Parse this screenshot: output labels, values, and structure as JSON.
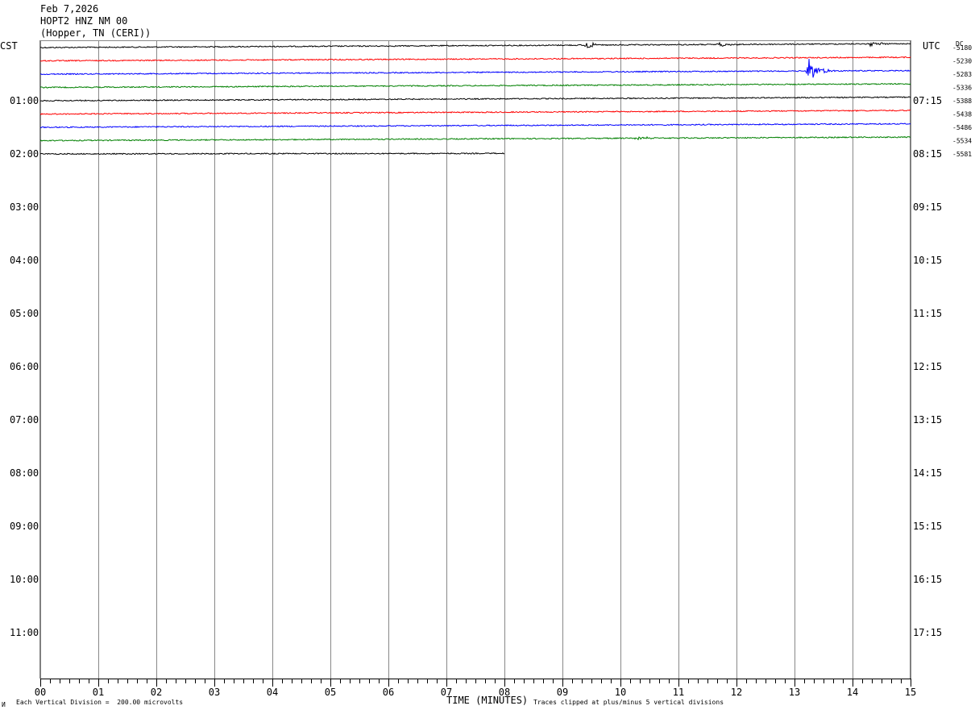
{
  "header": {
    "date": "Feb 7,2026",
    "station": "HOPT2 HNZ NM 00",
    "location": "(Hopper, TN (CERI))"
  },
  "left_timezone": "CST",
  "right_timezone": "UTC",
  "dc_header": "DC",
  "footer": {
    "corner_mark": "И",
    "scale_note": "Each Vertical Division =  200.00 microvolts",
    "axis_title": "TIME (MINUTES)",
    "clip_note": "Traces clipped at plus/minus 5 vertical divisions"
  },
  "colors": {
    "grid": "#888888",
    "traces": [
      "#000000",
      "#ff0000",
      "#0000ff",
      "#008000"
    ]
  },
  "chart_data": {
    "type": "line",
    "title": "",
    "xlabel": "TIME (MINUTES)",
    "ylabel": "",
    "xlim": [
      0,
      15
    ],
    "x_tick_labels": [
      "00",
      "01",
      "02",
      "03",
      "04",
      "05",
      "06",
      "07",
      "08",
      "09",
      "10",
      "11",
      "12",
      "13",
      "14",
      "15"
    ],
    "left_time_labels": [
      "01:00",
      "02:00",
      "03:00",
      "04:00",
      "05:00",
      "06:00",
      "07:00",
      "08:00",
      "09:00",
      "10:00",
      "11:00"
    ],
    "right_time_labels": [
      "07:15",
      "08:15",
      "09:15",
      "10:15",
      "11:15",
      "12:15",
      "13:15",
      "14:15",
      "15:15",
      "16:15",
      "17:15"
    ],
    "dc_offsets": [
      "-5180",
      "-5230",
      "-5283",
      "-5336",
      "-5388",
      "-5438",
      "-5486",
      "-5534",
      "-5581"
    ],
    "traces": [
      {
        "line": 0,
        "color": "#000000",
        "start_level": 0.0,
        "end_level": -0.6,
        "end_minute": 15,
        "events": [
          {
            "minute": 9.4,
            "amplitude": 0.5
          },
          {
            "minute": 11.7,
            "amplitude": 0.3
          },
          {
            "minute": 14.3,
            "amplitude": 0.35
          }
        ]
      },
      {
        "line": 1,
        "color": "#ff0000",
        "start_level": 0.0,
        "end_level": -0.55,
        "end_minute": 15,
        "events": []
      },
      {
        "line": 2,
        "color": "#0000ff",
        "start_level": 0.0,
        "end_level": -0.55,
        "end_minute": 15,
        "events": [
          {
            "minute": 13.25,
            "amplitude": 1.7
          }
        ]
      },
      {
        "line": 3,
        "color": "#008000",
        "start_level": 0.0,
        "end_level": -0.55,
        "end_minute": 15,
        "events": []
      },
      {
        "line": 4,
        "color": "#000000",
        "start_level": 0.0,
        "end_level": -0.55,
        "end_minute": 15,
        "events": []
      },
      {
        "line": 5,
        "color": "#ff0000",
        "start_level": 0.0,
        "end_level": -0.55,
        "end_minute": 15,
        "events": []
      },
      {
        "line": 6,
        "color": "#0000ff",
        "start_level": 0.0,
        "end_level": -0.55,
        "end_minute": 15,
        "events": []
      },
      {
        "line": 7,
        "color": "#008000",
        "start_level": 0.0,
        "end_level": -0.55,
        "end_minute": 15,
        "events": [
          {
            "minute": 10.3,
            "amplitude": 0.3
          }
        ]
      },
      {
        "line": 8,
        "color": "#000000",
        "start_level": 0.0,
        "end_level": -0.15,
        "end_minute": 8,
        "events": []
      }
    ],
    "grid": true
  }
}
